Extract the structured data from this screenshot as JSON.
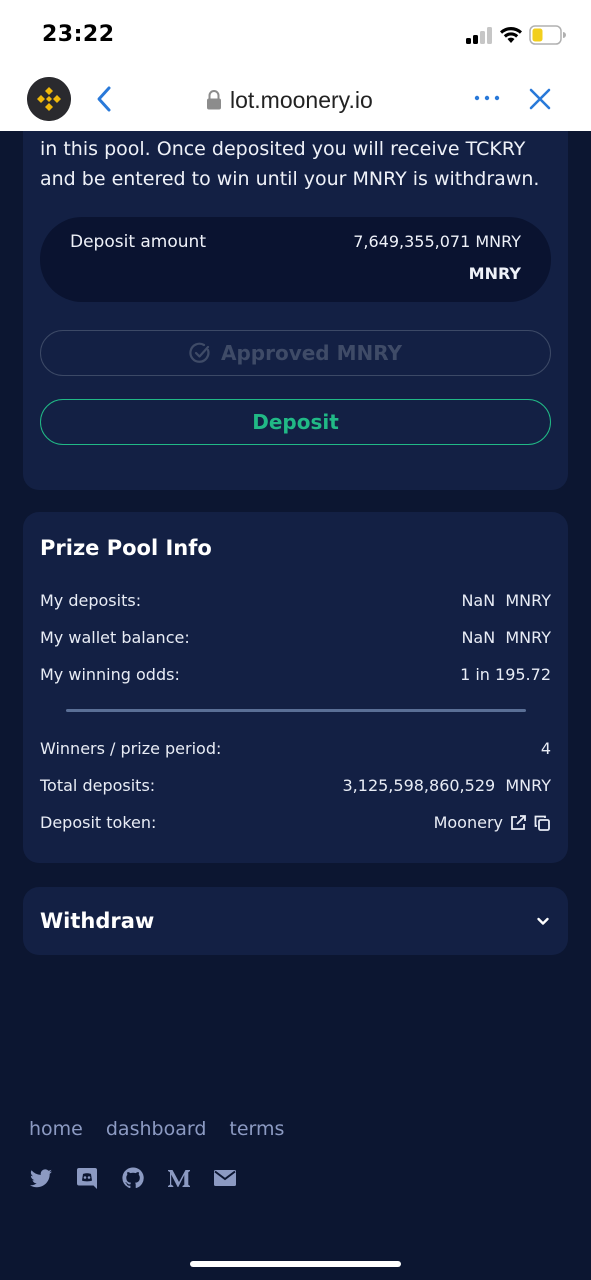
{
  "status_bar": {
    "time": "23:22"
  },
  "browser": {
    "url": "lot.moonery.io"
  },
  "deposit_card": {
    "intro": "in this pool. Once deposited you will receive TCKRY and be entered to win until your MNRY is withdrawn.",
    "amount_label": "Deposit amount",
    "amount_value": "7,649,355,071 MNRY",
    "amount_unit": "MNRY",
    "approved_label": "Approved MNRY",
    "deposit_label": "Deposit"
  },
  "prize_pool": {
    "title": "Prize Pool Info",
    "rows": [
      {
        "label": "My deposits:",
        "value": "NaN  MNRY"
      },
      {
        "label": "My wallet balance:",
        "value": "NaN  MNRY"
      },
      {
        "label": "My winning odds:",
        "value": "1 in 195.72"
      },
      {
        "label": "Winners / prize period:",
        "value": "4"
      },
      {
        "label": "Total deposits:",
        "value": "3,125,598,860,529  MNRY"
      },
      {
        "label": "Deposit token:",
        "value": "Moonery"
      }
    ]
  },
  "withdraw": {
    "title": "Withdraw"
  },
  "footer": {
    "links": [
      "home",
      "dashboard",
      "terms"
    ],
    "social_icons": [
      "twitter-icon",
      "discord-icon",
      "github-icon",
      "medium-icon",
      "mail-icon"
    ]
  },
  "colors": {
    "background": "#0c1631",
    "card": "#132044",
    "accent_green": "#21b986",
    "muted": "#3f4b67",
    "link": "#8c9ac2"
  }
}
